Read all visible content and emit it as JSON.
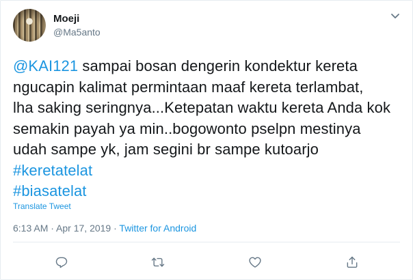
{
  "user": {
    "name": "Moeji",
    "handle": "@Ma5anto"
  },
  "tweet": {
    "mention": "@KAI121",
    "line1_rest": " sampai bosan dengerin kondektur kereta",
    "line2": "ngucapin kalimat permintaan maaf kereta terlambat,",
    "line3": "lha saking seringnya...Ketepatan waktu kereta Anda kok",
    "line4": "semakin payah ya min..bogowonto pselpn mestinya",
    "line5": "udah sampe yk, jam segini br sampe kutoarjo",
    "hashtags": [
      "#keretatelat",
      "#biasatelat"
    ]
  },
  "translate_label": "Translate Tweet",
  "meta": {
    "time": "6:13 AM",
    "separator": " · ",
    "date": "Apr 17, 2019",
    "source": "Twitter for Android"
  },
  "icons": {
    "menu": "chevron-down-icon",
    "reply": "reply-icon",
    "retweet": "retweet-icon",
    "like": "heart-icon",
    "share": "share-icon"
  },
  "colors": {
    "link": "#1b95e0",
    "muted": "#657786",
    "text": "#14171a"
  }
}
